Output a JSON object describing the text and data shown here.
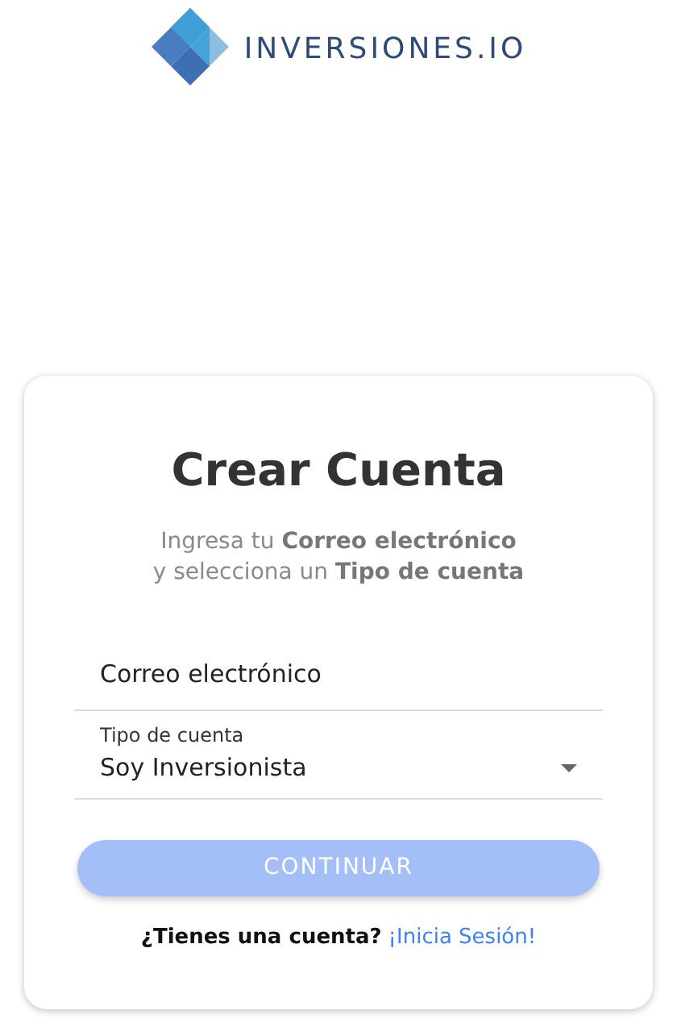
{
  "logo": {
    "text": "INVERSIONES.IO"
  },
  "card": {
    "title": "Crear Cuenta",
    "subtitle_lines": [
      "Ingresa tu **Correo electrónico**",
      "y selecciona un **Tipo de cuenta**"
    ],
    "email_field": {
      "placeholder": "Correo electrónico"
    },
    "account_type": {
      "label": "Tipo de cuenta",
      "value": "Soy Inversionista"
    },
    "continue_button": {
      "label": "CONTINUAR",
      "disabled": true
    },
    "footer": {
      "question": "¿Tienes una cuenta?",
      "link": "¡Inicia Sesión!"
    }
  }
}
